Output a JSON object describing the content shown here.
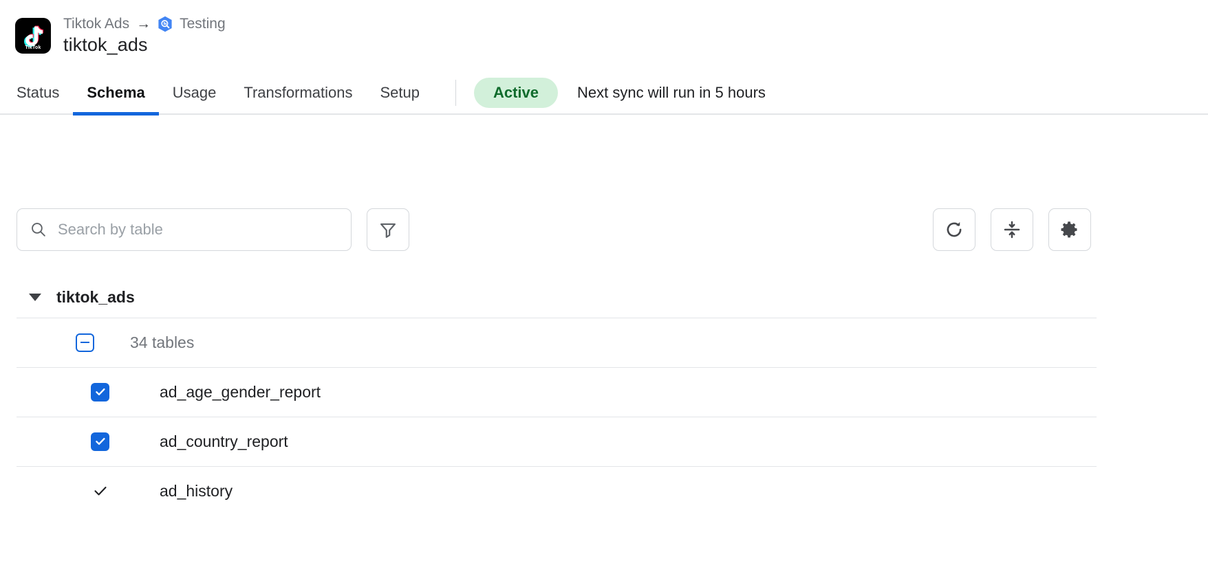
{
  "header": {
    "connector_icon": "tiktok-logo",
    "breadcrumb": {
      "source": "Tiktok Ads",
      "arrow": "→",
      "destination": "Testing",
      "destination_icon": "bigquery-icon"
    },
    "title": "tiktok_ads",
    "logo_wordmark": "TikTok"
  },
  "tabs": [
    {
      "label": "Status",
      "active": false
    },
    {
      "label": "Schema",
      "active": true
    },
    {
      "label": "Usage",
      "active": false
    },
    {
      "label": "Transformations",
      "active": false
    },
    {
      "label": "Setup",
      "active": false
    }
  ],
  "status": {
    "badge": "Active",
    "badge_bg": "#d2f0da",
    "badge_color": "#0f6b2c",
    "sync_message": "Next sync will run in 5 hours"
  },
  "toolbar": {
    "search_placeholder": "Search by table",
    "search_value": "",
    "filter_icon": "filter-icon",
    "refresh_icon": "refresh-icon",
    "collapse_icon": "collapse-all-icon",
    "settings_icon": "gear-icon"
  },
  "schema": {
    "name": "tiktok_ads",
    "expanded": true,
    "summary_label": "34 tables",
    "summary_state": "indeterminate",
    "tables": [
      {
        "name": "ad_age_gender_report",
        "state": "checked"
      },
      {
        "name": "ad_country_report",
        "state": "checked"
      },
      {
        "name": "ad_history",
        "state": "locked"
      }
    ]
  },
  "colors": {
    "accent": "#1266dc",
    "border": "#e3e5e8",
    "muted_text": "#72767c"
  }
}
